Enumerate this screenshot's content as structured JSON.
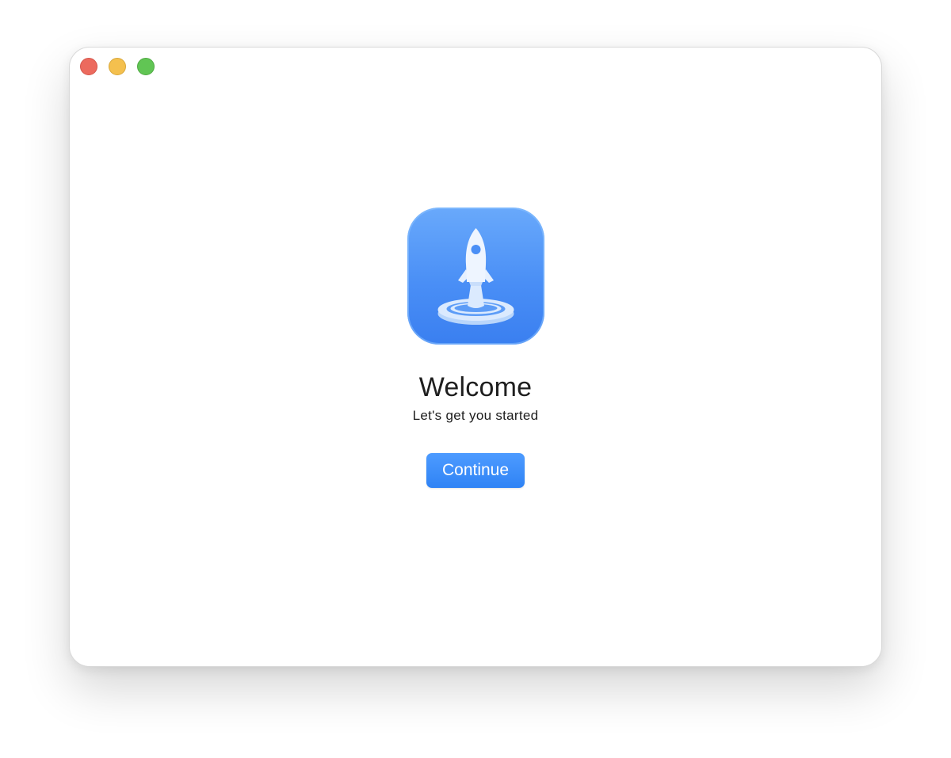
{
  "window": {
    "traffic_lights": [
      {
        "name": "close",
        "color": "#ec6a5e"
      },
      {
        "name": "minimize",
        "color": "#f4c04e"
      },
      {
        "name": "zoom",
        "color": "#61c554"
      }
    ]
  },
  "app_icon": {
    "icon": "rocket-launch-icon",
    "accent": "#4a8ff6"
  },
  "welcome": {
    "title": "Welcome",
    "subtitle": "Let's get you started",
    "continue_label": "Continue",
    "button_color": "#3a8cf8"
  }
}
